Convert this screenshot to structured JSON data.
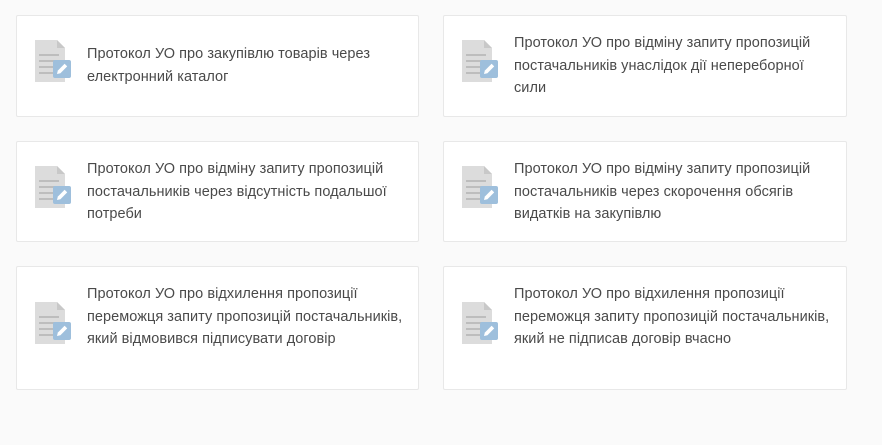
{
  "icons": {
    "document": "document-edit-icon"
  },
  "colors": {
    "page_background": "#fafafa",
    "card_background": "#ffffff",
    "card_border": "#e8e8e8",
    "text": "#4a4a4a",
    "icon_paper": "#dcdcdc",
    "icon_badge": "#9ebfdc"
  },
  "cards": [
    {
      "title": "Протокол УО про закупівлю товарів через електронний каталог"
    },
    {
      "title": "Протокол УО про відміну запиту пропозицій постачальників унаслідок дії непереборної сили"
    },
    {
      "title": "Протокол УО про відміну запиту пропозицій постачальників через відсутність подальшої потреби"
    },
    {
      "title": "Протокол УО про відміну запиту пропозицій постачальників через скорочення обсягів видатків на закупівлю"
    },
    {
      "title": "Протокол УО про відхилення пропозиції переможця запиту пропозицій постачальників, який відмовився підписувати договір"
    },
    {
      "title": "Протокол УО про відхилення пропозиції переможця запиту пропозицій постачальників, який не підписав договір вчасно"
    }
  ]
}
